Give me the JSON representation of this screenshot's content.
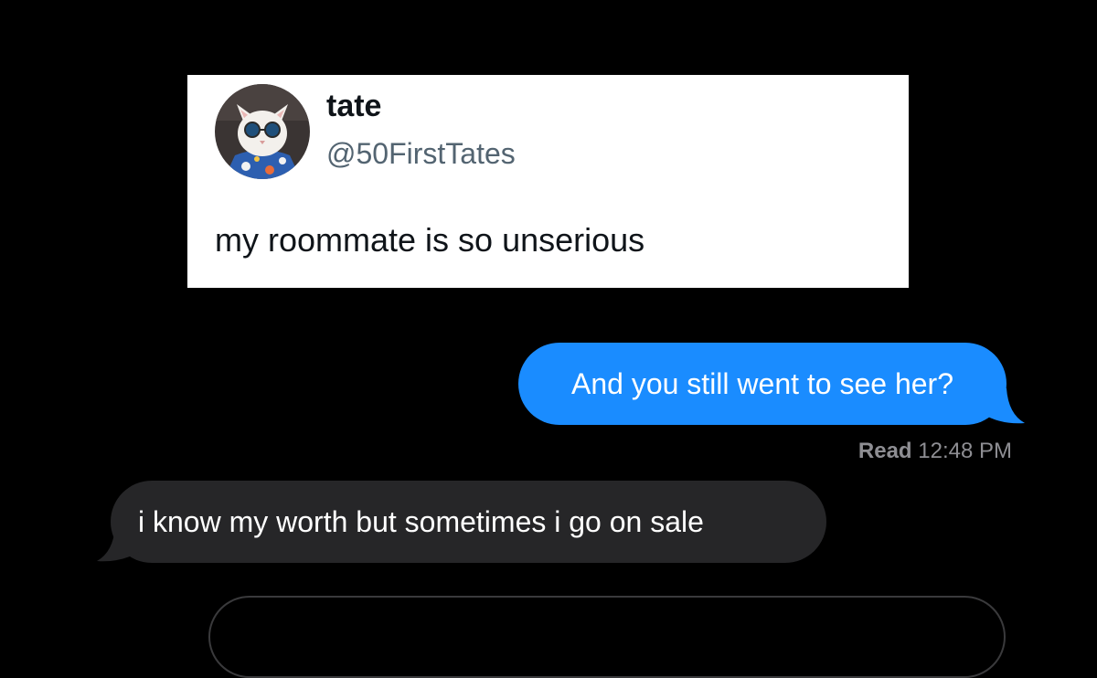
{
  "tweet": {
    "display_name": "tate",
    "handle": "@50FirstTates",
    "text": "my roommate is so unserious"
  },
  "thread": {
    "sent_message": "And you still went to see her?",
    "read_label": "Read",
    "read_time": "12:48 PM",
    "received_message": "i know my worth but sometimes i go on sale"
  },
  "colors": {
    "background": "#000000",
    "sent_bubble": "#1a8cff",
    "received_bubble": "#262628",
    "handle": "#536471",
    "receipt": "#8e8e93"
  }
}
